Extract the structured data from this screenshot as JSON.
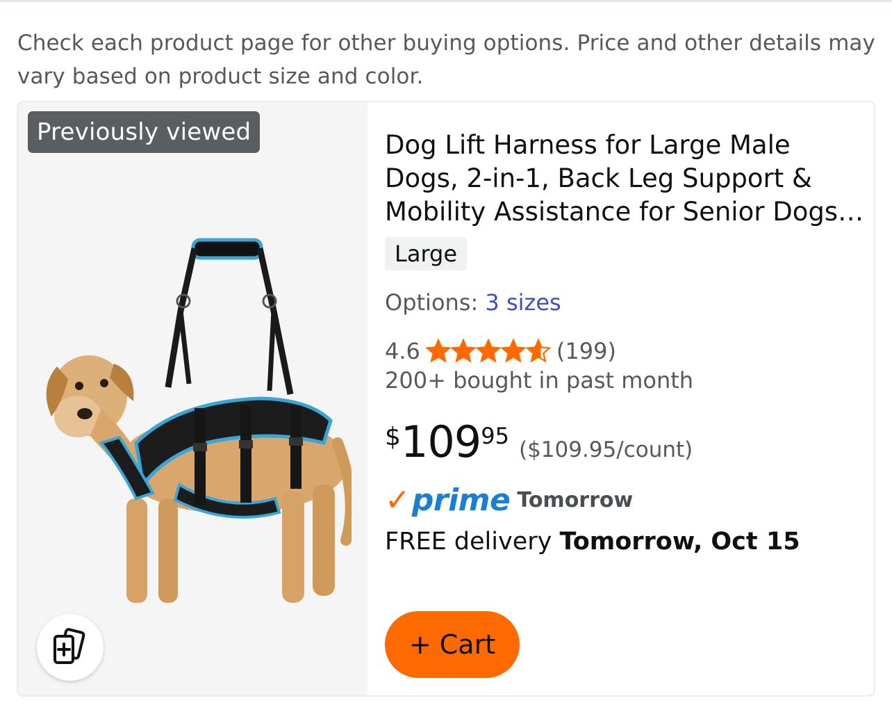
{
  "disclaimer": "Check each product page for other buying options. Price and other details may vary based on product size and color.",
  "badge": "Previously viewed",
  "product": {
    "title": "Dog Lift Harness for Large Male Dogs, 2-in-1, Back Leg Support & Mobility Assistance for Senior Dogs, Post-...",
    "size": "Large",
    "options_label": "Options:",
    "options_value": "3 sizes",
    "rating": "4.6",
    "rating_stars": 4.6,
    "review_count": "(199)",
    "bought": "200+ bought in past month",
    "price_symbol": "$",
    "price_whole": "109",
    "price_fraction": "95",
    "unit_price": "($109.95/count)",
    "prime_check": "✓",
    "prime_word": "prime",
    "prime_when": "Tomorrow",
    "delivery_prefix": "FREE delivery",
    "delivery_date": "Tomorrow, Oct 15",
    "cart_label": "+ Cart"
  },
  "colors": {
    "accent_orange": "#ff6a00",
    "prime_blue": "#1a7ed2",
    "link_blue": "#3b4fc4",
    "star": "#ff6a00"
  },
  "icons": {
    "compare": "compare-cards-icon",
    "star": "star-icon"
  }
}
